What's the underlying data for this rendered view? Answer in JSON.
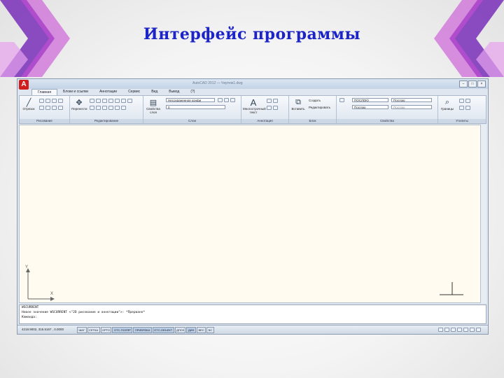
{
  "slide": {
    "title": "Интерфейс программы"
  },
  "app": {
    "logo": "A",
    "window_title": "AutoCAD 2012 — Чертеж1.dwg",
    "window_controls": [
      "–",
      "□",
      "×"
    ],
    "tabs": [
      "Главная",
      "Блоки и ссылки",
      "Аннотации",
      "Сервис",
      "Вид",
      "Вывод",
      "(?)"
    ],
    "ribbon": {
      "draw": {
        "label": "Рисование",
        "tool": "Отрезок"
      },
      "modify": {
        "label": "Редактирование",
        "tool": "Перенести"
      },
      "layers": {
        "label": "Слои",
        "tool": "Свойства слоя",
        "state_dropdown": "Несохраненное конфи",
        "layer_dropdown": "0"
      },
      "annotation": {
        "label": "Аннотация",
        "tool": "Многострочный текст"
      },
      "block": {
        "label": "Блок",
        "tool": "Вставить",
        "create": "Создать",
        "edit": "Редактировать"
      },
      "properties": {
        "label": "Свойства",
        "color": "ПОСЛОЮ",
        "linetype": "Послою",
        "lineweight": "Послою",
        "plotstyle": "Послою"
      },
      "utilities": {
        "label": "Утилиты",
        "tool": "Границы"
      }
    },
    "ucs": {
      "x": "X",
      "y": "Y"
    },
    "command_lines": [
      "WSCURRENT",
      "Новое значение WSCURRENT <\"2D рисование и аннотации\">: *Прервано*",
      "Команда:"
    ],
    "status": {
      "coords": "4218.9002, 315.5167 , 0.0000",
      "toggles": [
        "ШАГ",
        "СЕТКА",
        "ОРТО",
        "ОТС-ПОЛЯР",
        "ПРИВЯЗКА",
        "ОТС-ОБЪЕКТ",
        "ДПСК",
        "ДИН",
        "ВЕС",
        "БС"
      ]
    }
  }
}
